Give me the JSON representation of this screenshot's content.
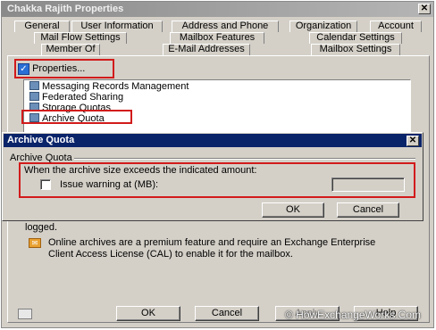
{
  "window": {
    "title": "Chakka Rajith Properties",
    "close_glyph": "✕"
  },
  "tabs": {
    "row1": [
      "General",
      "User Information",
      "Address and Phone",
      "Organization",
      "Account"
    ],
    "row2": [
      "Mail Flow Settings",
      "Mailbox Features",
      "Calendar Settings"
    ],
    "row3": [
      "Member Of",
      "E-Mail Addresses",
      "Mailbox Settings"
    ]
  },
  "toolbar": {
    "properties_label": "Properties..."
  },
  "tree": {
    "items": [
      "Messaging Records Management",
      "Federated Sharing",
      "Storage Quotas",
      "Archive Quota"
    ]
  },
  "archive_dialog": {
    "title": "Archive Quota",
    "close_glyph": "✕",
    "group_label": "Archive Quota",
    "description": "When the archive size exceeds the indicated amount:",
    "issue_warning_label": "Issue warning at (MB):",
    "issue_warning_value": "",
    "ok_label": "OK",
    "cancel_label": "Cancel"
  },
  "main": {
    "logged_text": "logged.",
    "archive_info": "Online archives are a premium feature and require an Exchange Enterprise Client Access License (CAL) to enable it for the mailbox."
  },
  "footer": {
    "ok_label": "OK",
    "cancel_label": "Cancel",
    "apply_label": "Apply",
    "help_label": "Help"
  },
  "watermark": "© HowExchangeWorks.Com",
  "colors": {
    "highlight_red": "#d21b1b",
    "dialog_title_bg": "#0a246a",
    "window_bg": "#d4d0c8"
  }
}
